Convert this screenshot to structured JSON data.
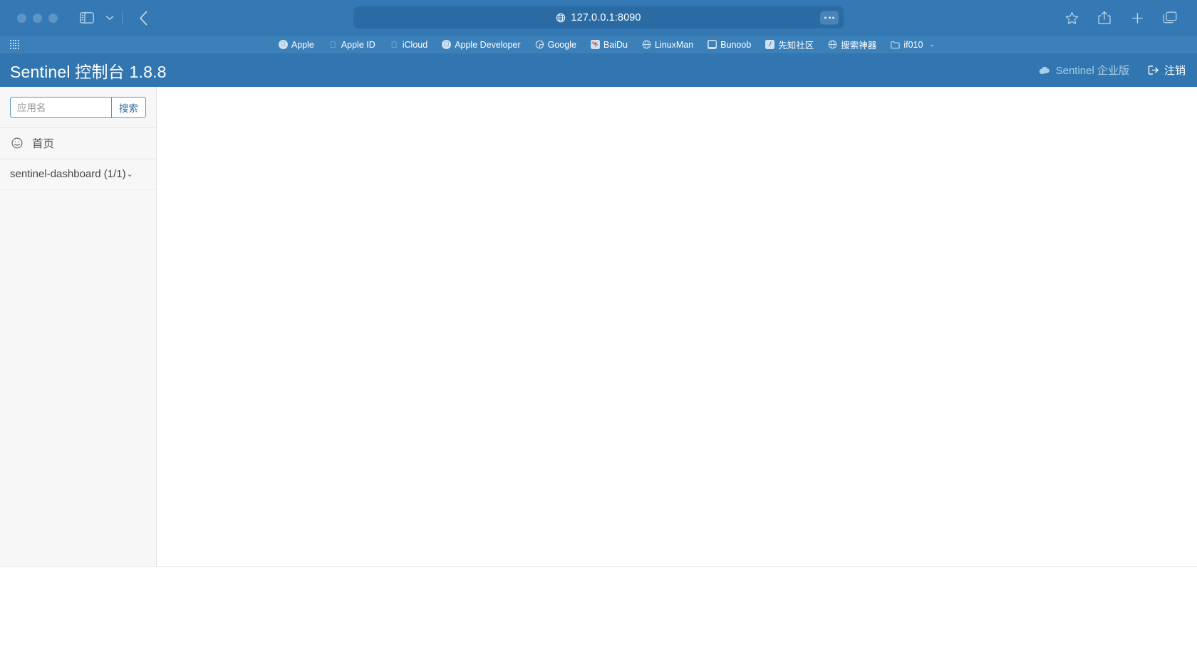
{
  "browser": {
    "traffic_lights": [
      "close",
      "minimize",
      "zoom"
    ],
    "sidebar_toggle_label": "sidebar-toggle",
    "back_label": "back",
    "address": {
      "url": "127.0.0.1:8090",
      "site_icon": "globe-icon",
      "page_menu_label": "page-settings"
    },
    "toolbar_right": [
      "share-icon",
      "new-tab-icon",
      "tab-overview-icon"
    ],
    "bookmarks": [
      {
        "label": "Apple",
        "icon": "apple-circle-icon"
      },
      {
        "label": "Apple ID",
        "icon": "apple-ghost-icon"
      },
      {
        "label": "iCloud",
        "icon": "apple-ghost-icon"
      },
      {
        "label": "Apple Developer",
        "icon": "apple-circle-icon"
      },
      {
        "label": "Google",
        "icon": "google-circle-icon"
      },
      {
        "label": "BaiDu",
        "icon": "baidu-square-icon"
      },
      {
        "label": "LinuxMan",
        "icon": "globe-icon"
      },
      {
        "label": "Bunoob",
        "icon": "runoob-square-icon"
      },
      {
        "label": "先知社区",
        "icon": "xianzhi-square-icon"
      },
      {
        "label": "搜索神器",
        "icon": "globe-icon"
      },
      {
        "label": "if010",
        "icon": "folder-icon",
        "chevron": "⌄"
      }
    ]
  },
  "app": {
    "title": "Sentinel 控制台 1.8.8",
    "enterprise_label": "Sentinel 企业版",
    "enterprise_icon": "cloud-icon",
    "logout_label": "注销",
    "logout_icon": "logout-icon"
  },
  "sidebar": {
    "search": {
      "placeholder": "应用名",
      "value": "",
      "button_label": "搜索"
    },
    "home": {
      "label": "首页",
      "icon": "dashboard-gauge-icon"
    },
    "app_group": {
      "label": "sentinel-dashboard (1/1)",
      "chevron": "⌄"
    }
  },
  "colors": {
    "chrome_blue": "#3479b4",
    "bookmarks_blue": "#3c80ba",
    "app_header_blue": "#3276b1",
    "address_bar_blue": "#2b6ba3",
    "sidebar_bg": "#f7f7f7",
    "accent_link": "#2f6ca5",
    "enterprise_text": "#a8cfe6"
  }
}
